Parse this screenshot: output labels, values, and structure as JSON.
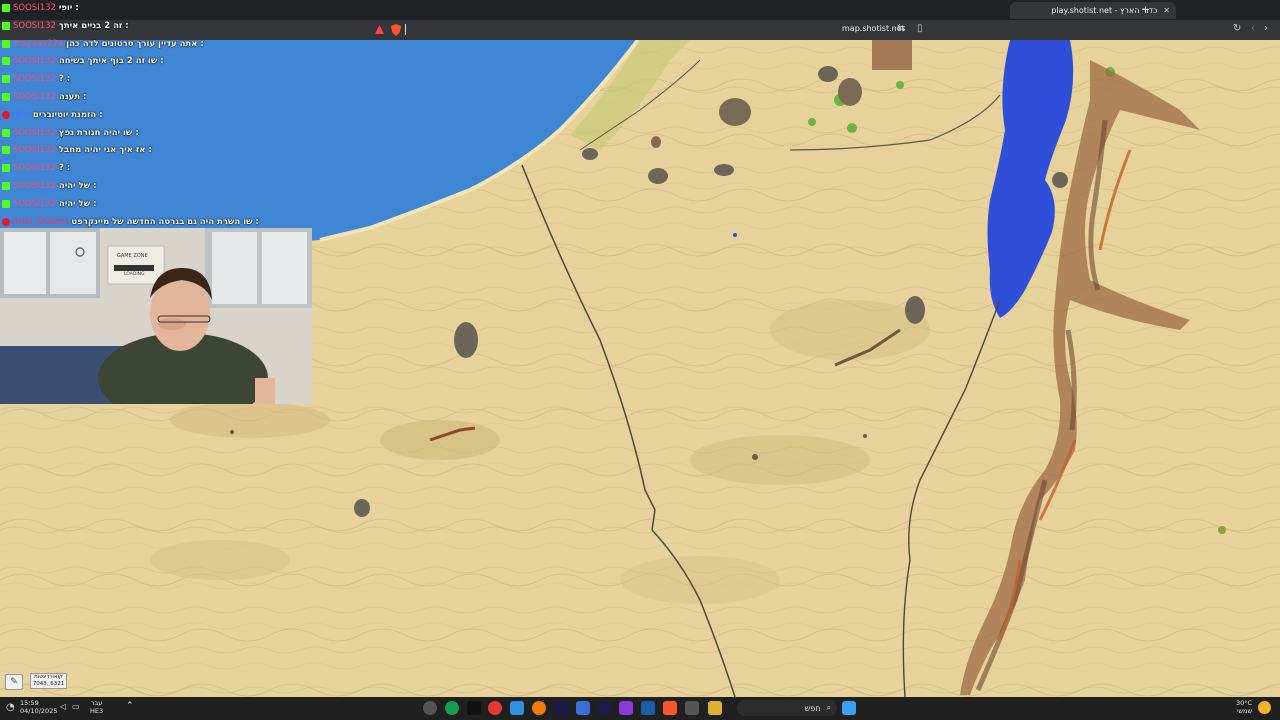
{
  "browser": {
    "active_tab_title": "play.shotist.net - כדור הארץ",
    "url": "map.shotist.net",
    "new_tab_label": "+",
    "close_tab_label": "✕"
  },
  "chat": {
    "messages": [
      {
        "user": "SOOSI132",
        "badge": "kick",
        "text": "יופי :"
      },
      {
        "user": "SOOSI132",
        "badge": "kick",
        "text": "זה 2 בניים איתך :"
      },
      {
        "user": "mayaaa22a",
        "badge": "kick",
        "text": "אתה עדיין עורך סרטונים לדה כהן :"
      },
      {
        "user": "SOOSI132",
        "badge": "kick",
        "text": "שו זה 2 בוף איתך בשיחה :"
      },
      {
        "user": "SOOSI132",
        "badge": "kick",
        "text": "? :"
      },
      {
        "user": "SOOSI132",
        "badge": "kick",
        "text": "תענה :"
      },
      {
        "user": "iBut",
        "badge": "yt",
        "text": "הזמנת יוטיוברים :"
      },
      {
        "user": "SOOSI132",
        "badge": "kick",
        "text": "שו יהיה חגורת נפץ :"
      },
      {
        "user": "SOOSI132",
        "badge": "kick",
        "text": "אז איך אני יהיה מחבל :"
      },
      {
        "user": "SOOSI132",
        "badge": "kick",
        "text": "? :"
      },
      {
        "user": "SOOSI132",
        "badge": "kick",
        "text": "של יהיה :"
      },
      {
        "user": "SOOSI132",
        "badge": "kick",
        "text": "של יהיה :"
      },
      {
        "user": "Ariel_Shalom",
        "badge": "yt",
        "text": "שו השרת היה גם בגרסה החדשה של מיינקרפט :"
      }
    ]
  },
  "webcam": {
    "sign_line1": "GAME ZONE",
    "sign_line2": "LOADING"
  },
  "map_overlay": {
    "coords_label": "קואורדינטות",
    "coords_value": "7043, 6321",
    "pin_icon": "pin-icon"
  },
  "taskbar": {
    "time": "15:59",
    "date": "04/10/2025",
    "lang_top": "עבר",
    "lang_bottom": "HE3",
    "search_placeholder": "חפש",
    "weather_temp": "30°C",
    "weather_text": "שמשי"
  },
  "colors": {
    "sand": "#e7d39b",
    "sea": "#3f86d4",
    "lake": "#2f4fd8",
    "kick_green": "#53fc18"
  }
}
